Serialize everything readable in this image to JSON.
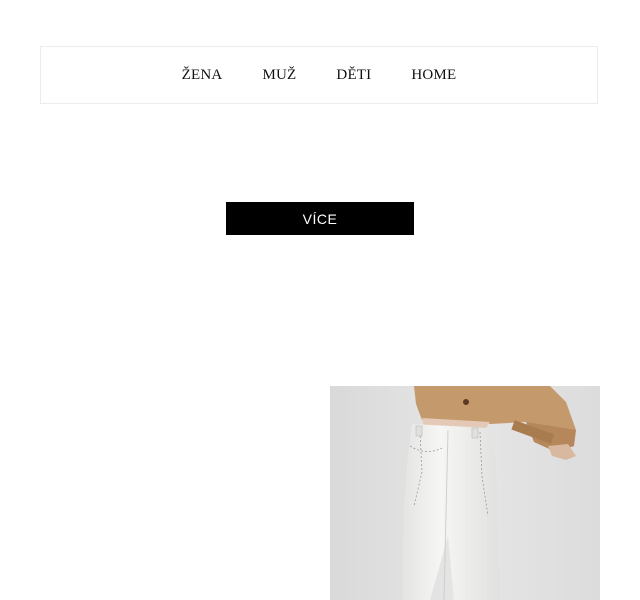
{
  "nav": {
    "items": [
      {
        "label": "ŽENA"
      },
      {
        "label": "MUŽ"
      },
      {
        "label": "DĚTI"
      },
      {
        "label": "HOME"
      }
    ]
  },
  "hero": {
    "button_label": "VÍCE"
  },
  "product": {
    "image_alt": "model in beige cropped jacket and white jeans",
    "colors": {
      "background": "#e2e2e2",
      "jacket": "#c49a6c",
      "jeans": "#f2f2f0"
    }
  }
}
